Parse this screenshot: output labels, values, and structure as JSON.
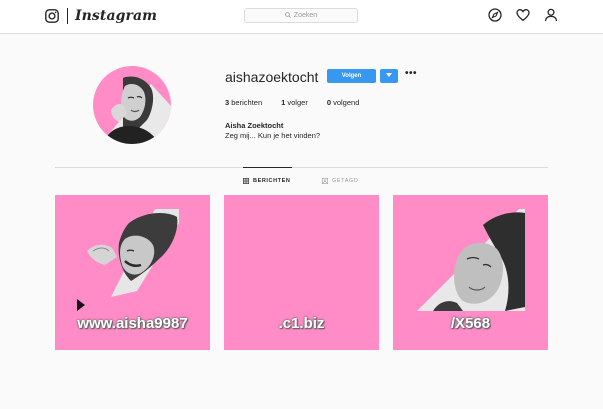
{
  "header": {
    "wordmark": "Instagram",
    "search_placeholder": "Zoeken",
    "icons": [
      "instagram-camera-icon",
      "explore-compass-icon",
      "activity-heart-icon",
      "profile-person-icon"
    ]
  },
  "profile": {
    "username": "aishazoektocht",
    "follow_label": "Volgen",
    "more_label": "•••",
    "stats": {
      "posts_count": "3",
      "posts_label": "berichten",
      "followers_count": "1",
      "followers_label": "volger",
      "following_count": "0",
      "following_label": "volgend"
    },
    "full_name": "Aisha Zoektocht",
    "bio": "Zeg mij... Kun je het vinden?"
  },
  "tabs": [
    {
      "label": "BERICHTEN",
      "active": true
    },
    {
      "label": "GETAGD",
      "active": false
    }
  ],
  "posts": [
    {
      "caption": "www.aisha9987"
    },
    {
      "caption": ".c1.biz"
    },
    {
      "caption": "/X568"
    }
  ],
  "colors": {
    "post_background": "#ff8cc6",
    "accent_blue": "#3897f0"
  }
}
